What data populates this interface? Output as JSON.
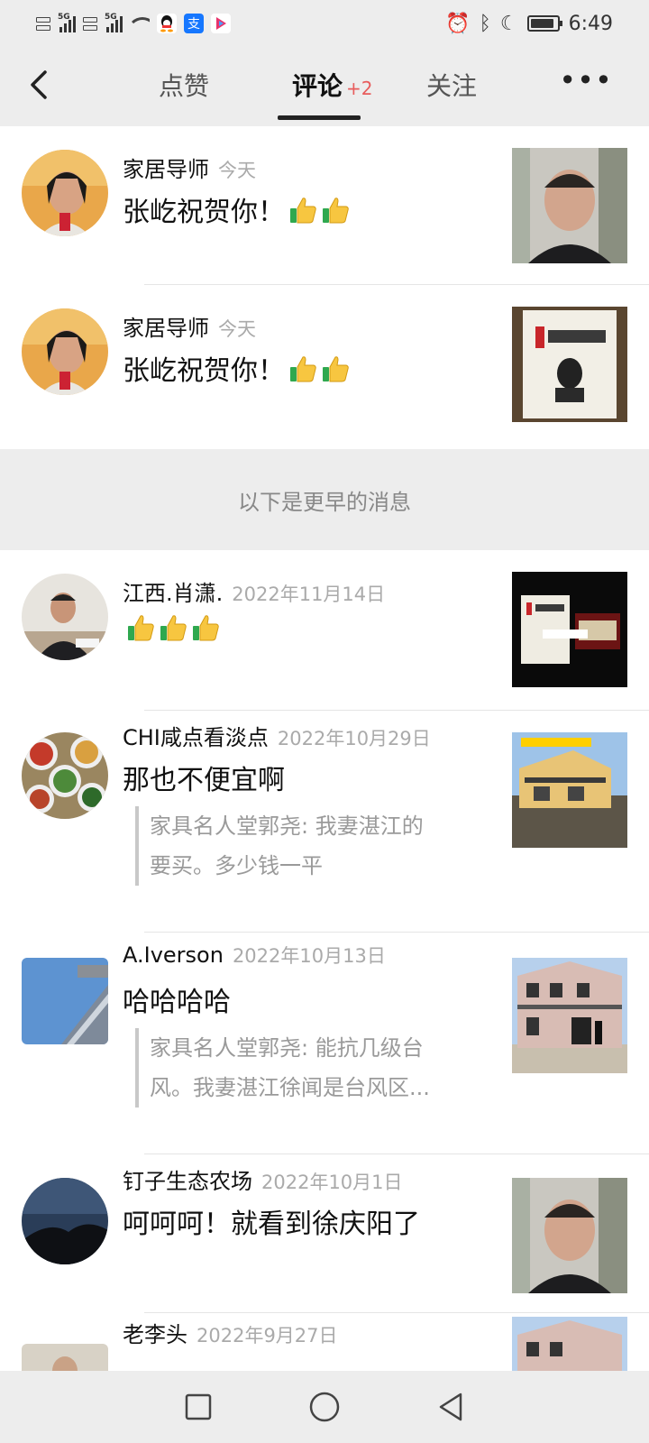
{
  "status_bar": {
    "net1": "5G",
    "net2": "5G",
    "time": "6:49",
    "battery_level": 0.9
  },
  "nav": {
    "tabs": [
      {
        "label": "点赞",
        "active": false
      },
      {
        "label": "评论",
        "active": true,
        "badge": "+2"
      },
      {
        "label": "关注",
        "active": false
      }
    ],
    "more_label": "•••"
  },
  "earlier_label": "以下是更早的消息",
  "items": [
    {
      "name": "家居导师",
      "date": "今天",
      "comment": "张屹祝贺你！",
      "thumbs": 2,
      "avatar": "avatar-man-glasses",
      "thumb": "thumb-man-video"
    },
    {
      "name": "家居导师",
      "date": "今天",
      "comment": "张屹祝贺你！",
      "thumbs": 2,
      "avatar": "avatar-man-glasses",
      "thumb": "thumb-book-cover"
    },
    {
      "name": "江西.肖潇.",
      "date": "2022年11月14日",
      "comment": "",
      "thumbs": 3,
      "avatar": "avatar-man-desk",
      "thumb": "thumb-book-video"
    },
    {
      "name": "CHI咸点看淡点",
      "date": "2022年10月29日",
      "comment": "那也不便宜啊",
      "quote": [
        "家具名人堂郭尧: 我妻湛江的",
        "要买。多少钱一平"
      ],
      "avatar": "avatar-food-plates",
      "thumb": "thumb-house-yellow"
    },
    {
      "name": "A.Iverson",
      "date": "2022年10月13日",
      "comment": "哈哈哈哈",
      "quote": [
        "家具名人堂郭尧: 能抗几级台",
        "风。我妻湛江徐闻是台风区..."
      ],
      "avatar": "avatar-building-sky",
      "thumb": "thumb-house-two-floor"
    },
    {
      "name": "钉子生态农场",
      "date": "2022年10月1日",
      "comment": "呵呵呵！就看到徐庆阳了",
      "avatar": "avatar-night-sky",
      "thumb": "thumb-man-video"
    },
    {
      "name": "老李头",
      "date": "2022年9月27日",
      "comment": "",
      "avatar": "avatar-person",
      "thumb": "thumb-house-two-floor"
    }
  ],
  "colors": {
    "background": "#ededed",
    "badge": "#e85c5c",
    "date": "#aaaaaa",
    "quote_bar": "#c8c8c8"
  }
}
